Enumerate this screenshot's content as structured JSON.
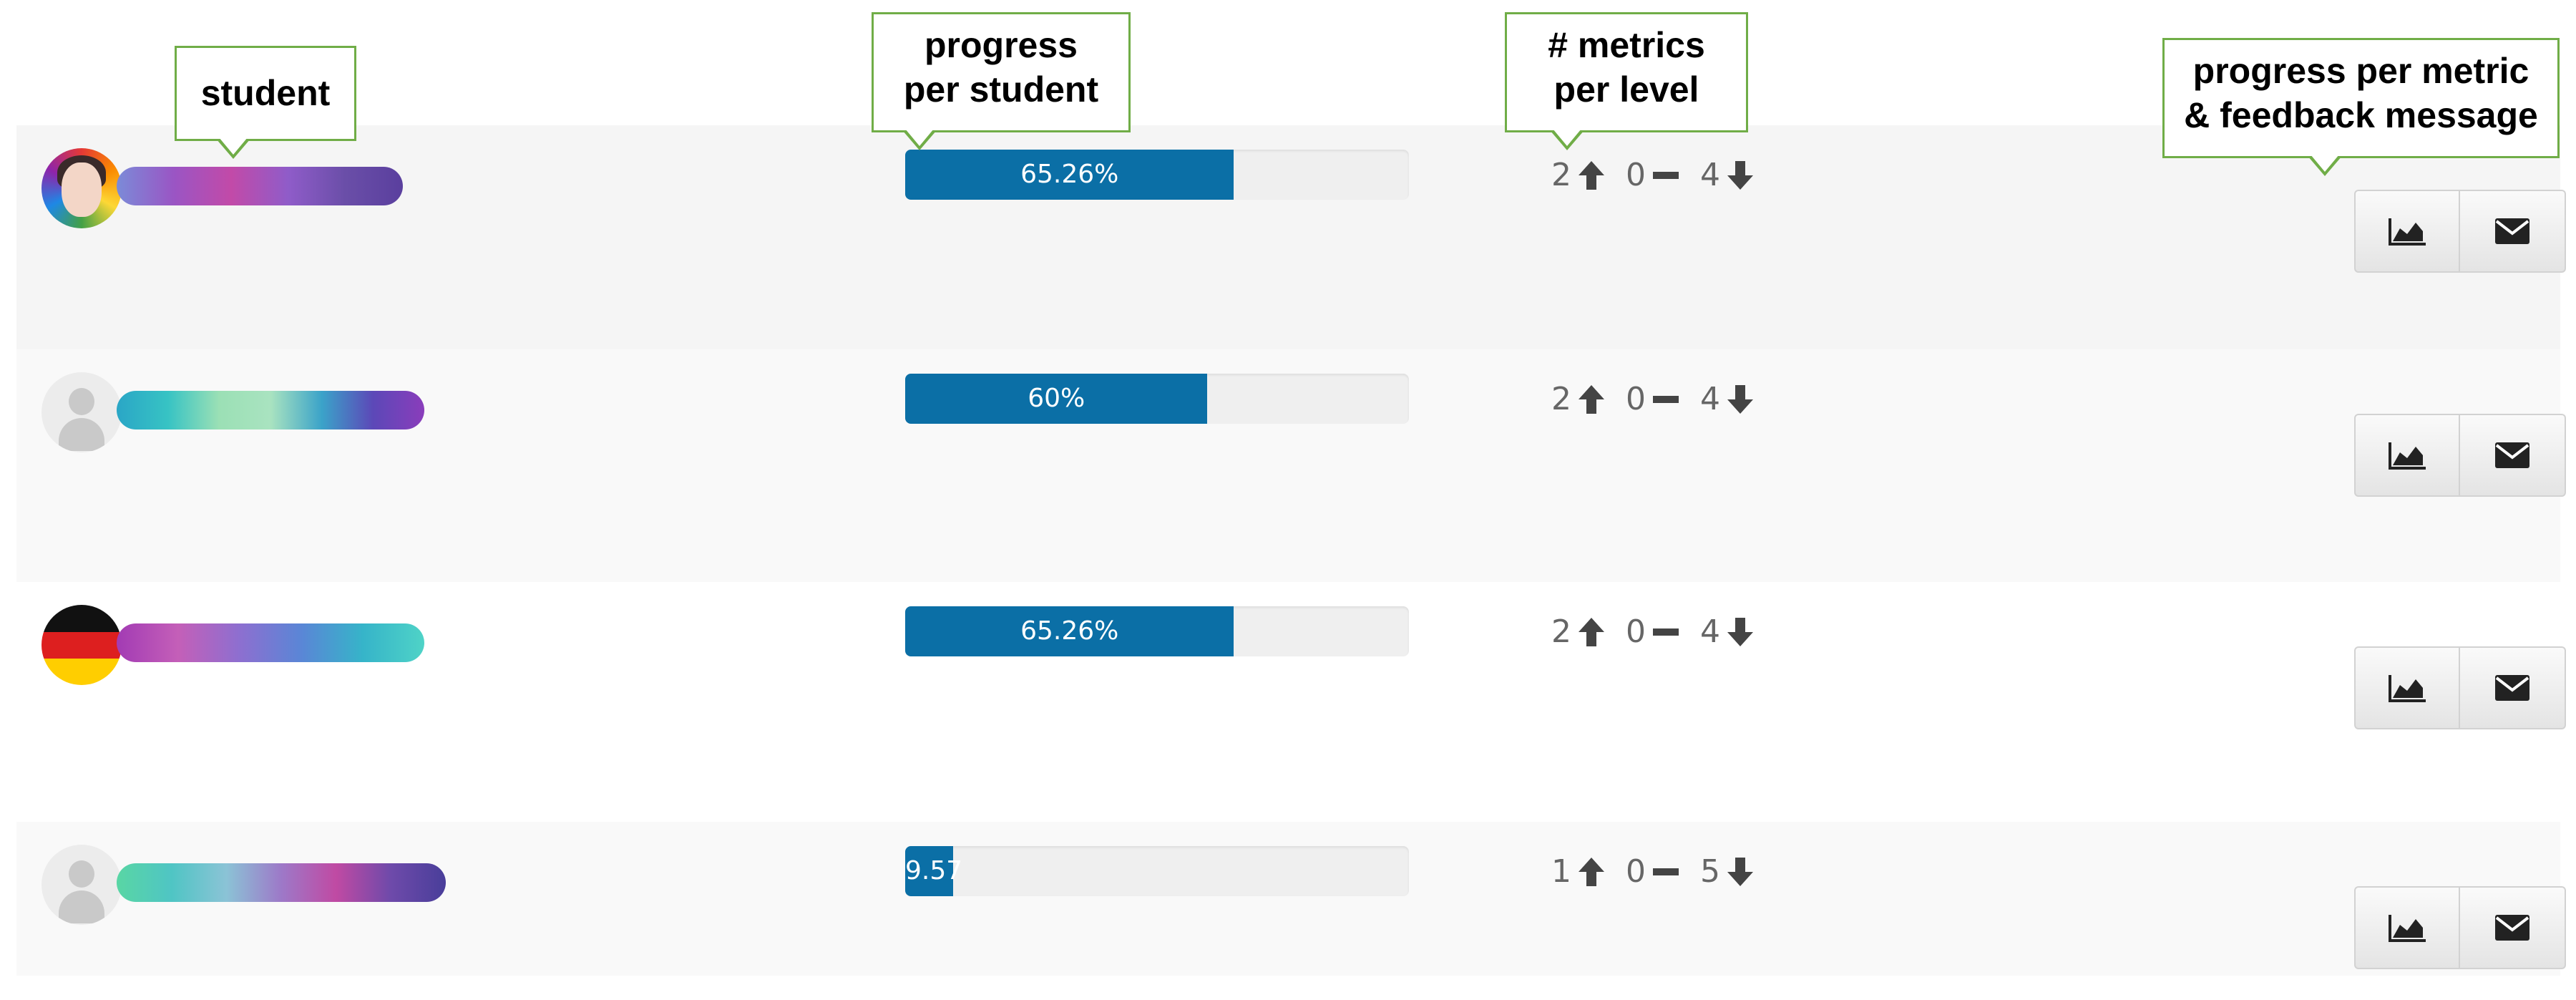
{
  "callouts": {
    "student": "student",
    "progress_line1": "progress",
    "progress_line2": "per student",
    "metrics_line1": "# metrics",
    "metrics_line2": "per level",
    "feedback_line1": "progress per metric",
    "feedback_line2": "& feedback message"
  },
  "colors": {
    "progress_fill": "#0b6fa6",
    "callout_border": "#70ad47"
  },
  "rows": [
    {
      "avatar": "avatar-girl",
      "progress_label": "65.26%",
      "progress_value": 65.26,
      "up": "2",
      "same": "0",
      "down": "4"
    },
    {
      "avatar": "avatar-default",
      "progress_label": "60%",
      "progress_value": 60,
      "up": "2",
      "same": "0",
      "down": "4"
    },
    {
      "avatar": "avatar-flag",
      "progress_label": "65.26%",
      "progress_value": 65.26,
      "up": "2",
      "same": "0",
      "down": "4"
    },
    {
      "avatar": "avatar-default",
      "progress_label": "9.57",
      "progress_value": 9.57,
      "up": "1",
      "same": "0",
      "down": "5"
    }
  ],
  "icons": {
    "up": "arrow-up-icon",
    "same": "minus-icon",
    "down": "arrow-down-icon",
    "chart": "area-chart-icon",
    "mail": "envelope-icon"
  }
}
